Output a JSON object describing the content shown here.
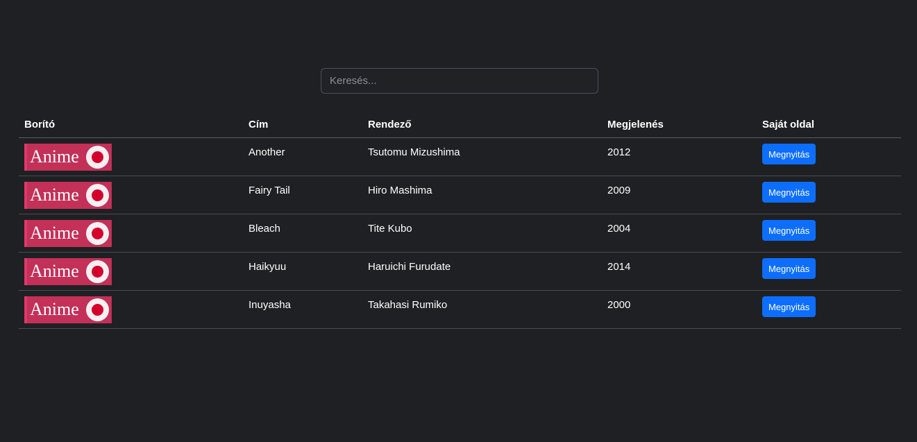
{
  "search": {
    "placeholder": "Keresés...",
    "value": ""
  },
  "table": {
    "headers": {
      "cover": "Borító",
      "title": "Cím",
      "director": "Rendező",
      "release": "Megjelenés",
      "own_page": "Saját oldal"
    },
    "rows": [
      {
        "cover_text": "Anime",
        "title": "Another",
        "director": "Tsutomu Mizushima",
        "year": "2012",
        "button": "Megnyitás"
      },
      {
        "cover_text": "Anime",
        "title": "Fairy Tail",
        "director": "Hiro Mashima",
        "year": "2009",
        "button": "Megnyitás"
      },
      {
        "cover_text": "Anime",
        "title": "Bleach",
        "director": "Tite Kubo",
        "year": "2004",
        "button": "Megnyitás"
      },
      {
        "cover_text": "Anime",
        "title": "Haikyuu",
        "director": "Haruichi Furudate",
        "year": "2014",
        "button": "Megnyitás"
      },
      {
        "cover_text": "Anime",
        "title": "Inuyasha",
        "director": "Takahasi Rumiko",
        "year": "2000",
        "button": "Megnyitás"
      }
    ]
  },
  "colors": {
    "background": "#1f2023",
    "button": "#0d6efd",
    "cover": "#c33058",
    "cover_dot": "#d3002c"
  }
}
